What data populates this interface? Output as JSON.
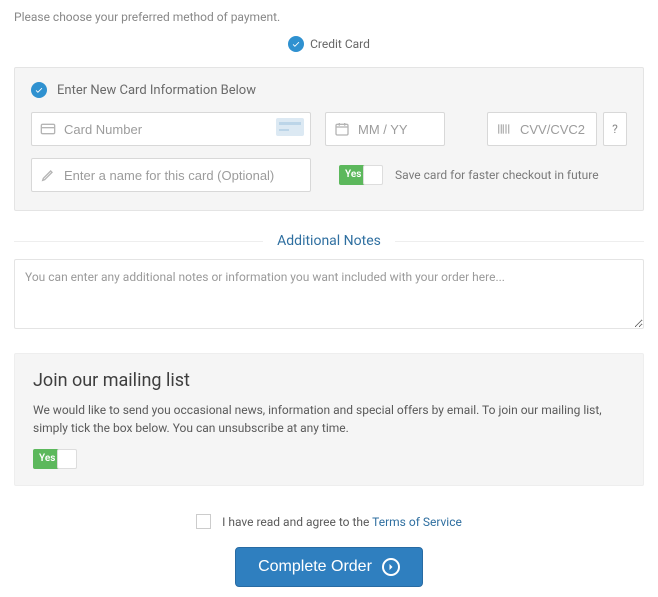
{
  "intro": "Please choose your preferred method of payment.",
  "method": {
    "credit_card_label": "Credit Card"
  },
  "card": {
    "panel_title": "Enter New Card Information Below",
    "number_placeholder": "Card Number",
    "expiry_placeholder": "MM / YY",
    "cvv_placeholder": "CVV/CVC2",
    "name_placeholder": "Enter a name for this card (Optional)",
    "help_label": "?",
    "save_toggle_yes": "Yes",
    "save_text": "Save card for faster checkout in future"
  },
  "notes": {
    "heading": "Additional Notes",
    "placeholder": "You can enter any additional notes or information you want included with your order here..."
  },
  "mailing": {
    "heading": "Join our mailing list",
    "body": "We would like to send you occasional news, information and special offers by email. To join our mailing list, simply tick the box below. You can unsubscribe at any time.",
    "toggle_yes": "Yes"
  },
  "tos": {
    "prefix": "I have read and agree to the ",
    "link": "Terms of Service"
  },
  "submit": {
    "label": "Complete Order"
  }
}
